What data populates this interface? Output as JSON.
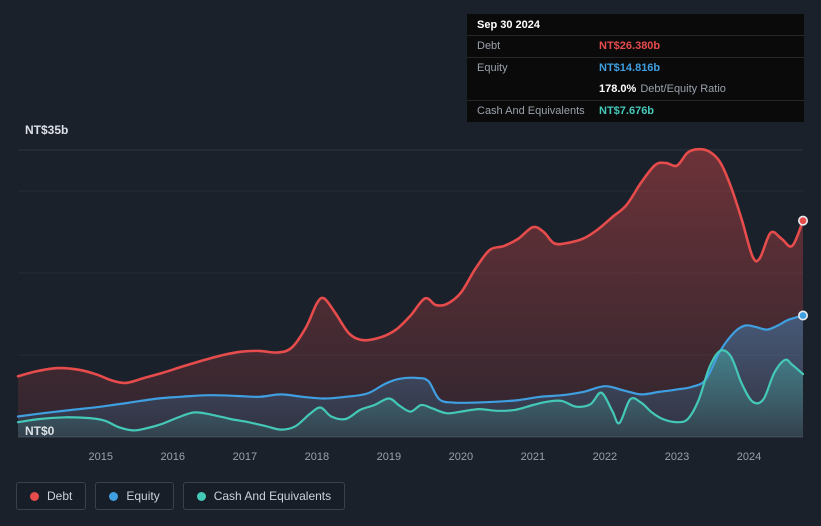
{
  "tooltip": {
    "date": "Sep 30 2024",
    "rows": [
      {
        "label": "Debt",
        "value": "NT$26.380b"
      },
      {
        "label": "Equity",
        "value": "NT$14.816b"
      },
      {
        "label": "",
        "value": "178.0%",
        "value_suffix": "Debt/Equity Ratio"
      },
      {
        "label": "Cash And Equivalents",
        "value": "NT$7.676b"
      }
    ]
  },
  "y_axis": {
    "max_label": "NT$35b",
    "min_label": "NT$0"
  },
  "x_axis": {
    "years": [
      "2015",
      "2016",
      "2017",
      "2018",
      "2019",
      "2020",
      "2021",
      "2022",
      "2023",
      "2024"
    ]
  },
  "legend": {
    "items": [
      {
        "label": "Debt",
        "color": "#e64c4c"
      },
      {
        "label": "Equity",
        "color": "#3f9fe0"
      },
      {
        "label": "Cash And Equivalents",
        "color": "#44c8b8"
      }
    ]
  },
  "colors": {
    "debt": "#e64c4c",
    "equity": "#3f9fe0",
    "cash": "#44c8b8",
    "background": "#1b212b",
    "tooltip_background": "#0a0a0b"
  },
  "chart_data": {
    "type": "area",
    "y_unit": "NT$ billions",
    "x_unit": "year",
    "x_range": [
      2013.85,
      2024.75
    ],
    "y_range": [
      0,
      35
    ],
    "gridlines_y": [
      10,
      20,
      30
    ],
    "legend_position": "bottom-left",
    "series": [
      {
        "name": "Debt",
        "color": "#e64c4c",
        "end_marker": true,
        "points": [
          [
            2013.85,
            7.4
          ],
          [
            2014.1,
            8.0
          ],
          [
            2014.4,
            8.4
          ],
          [
            2014.7,
            8.2
          ],
          [
            2014.95,
            7.6
          ],
          [
            2015.15,
            6.9
          ],
          [
            2015.35,
            6.6
          ],
          [
            2015.6,
            7.2
          ],
          [
            2015.85,
            7.8
          ],
          [
            2016.1,
            8.5
          ],
          [
            2016.4,
            9.3
          ],
          [
            2016.7,
            10.0
          ],
          [
            2016.95,
            10.4
          ],
          [
            2017.2,
            10.5
          ],
          [
            2017.45,
            10.3
          ],
          [
            2017.65,
            10.9
          ],
          [
            2017.85,
            13.4
          ],
          [
            2018.0,
            16.3
          ],
          [
            2018.1,
            16.9
          ],
          [
            2018.25,
            15.2
          ],
          [
            2018.45,
            12.6
          ],
          [
            2018.65,
            11.8
          ],
          [
            2018.9,
            12.2
          ],
          [
            2019.1,
            13.1
          ],
          [
            2019.3,
            14.8
          ],
          [
            2019.5,
            16.9
          ],
          [
            2019.65,
            16.1
          ],
          [
            2019.8,
            16.2
          ],
          [
            2020.0,
            17.6
          ],
          [
            2020.2,
            20.5
          ],
          [
            2020.4,
            22.8
          ],
          [
            2020.6,
            23.3
          ],
          [
            2020.8,
            24.2
          ],
          [
            2021.0,
            25.6
          ],
          [
            2021.15,
            25.0
          ],
          [
            2021.3,
            23.6
          ],
          [
            2021.5,
            23.7
          ],
          [
            2021.7,
            24.2
          ],
          [
            2021.9,
            25.3
          ],
          [
            2022.1,
            26.8
          ],
          [
            2022.3,
            28.3
          ],
          [
            2022.5,
            31.0
          ],
          [
            2022.7,
            33.2
          ],
          [
            2022.85,
            33.4
          ],
          [
            2023.0,
            33.1
          ],
          [
            2023.15,
            34.7
          ],
          [
            2023.3,
            35.1
          ],
          [
            2023.45,
            34.8
          ],
          [
            2023.6,
            33.5
          ],
          [
            2023.75,
            30.5
          ],
          [
            2023.9,
            26.5
          ],
          [
            2024.05,
            22.0
          ],
          [
            2024.15,
            21.8
          ],
          [
            2024.3,
            24.9
          ],
          [
            2024.45,
            24.2
          ],
          [
            2024.6,
            23.3
          ],
          [
            2024.75,
            26.38
          ]
        ]
      },
      {
        "name": "Equity",
        "color": "#3f9fe0",
        "end_marker": true,
        "points": [
          [
            2013.85,
            2.5
          ],
          [
            2014.2,
            2.9
          ],
          [
            2014.6,
            3.3
          ],
          [
            2015.0,
            3.7
          ],
          [
            2015.4,
            4.2
          ],
          [
            2015.8,
            4.7
          ],
          [
            2016.1,
            4.9
          ],
          [
            2016.5,
            5.1
          ],
          [
            2016.9,
            5.0
          ],
          [
            2017.2,
            4.9
          ],
          [
            2017.5,
            5.2
          ],
          [
            2017.8,
            4.9
          ],
          [
            2018.1,
            4.7
          ],
          [
            2018.4,
            4.9
          ],
          [
            2018.7,
            5.3
          ],
          [
            2018.95,
            6.5
          ],
          [
            2019.15,
            7.1
          ],
          [
            2019.4,
            7.2
          ],
          [
            2019.55,
            6.8
          ],
          [
            2019.7,
            4.6
          ],
          [
            2019.9,
            4.2
          ],
          [
            2020.2,
            4.2
          ],
          [
            2020.5,
            4.3
          ],
          [
            2020.8,
            4.5
          ],
          [
            2021.1,
            4.9
          ],
          [
            2021.4,
            5.1
          ],
          [
            2021.7,
            5.5
          ],
          [
            2022.0,
            6.2
          ],
          [
            2022.25,
            5.7
          ],
          [
            2022.5,
            5.2
          ],
          [
            2022.75,
            5.5
          ],
          [
            2023.0,
            5.8
          ],
          [
            2023.2,
            6.1
          ],
          [
            2023.4,
            7.0
          ],
          [
            2023.6,
            10.5
          ],
          [
            2023.8,
            12.8
          ],
          [
            2023.95,
            13.6
          ],
          [
            2024.1,
            13.4
          ],
          [
            2024.25,
            13.1
          ],
          [
            2024.4,
            13.6
          ],
          [
            2024.55,
            14.3
          ],
          [
            2024.75,
            14.816
          ]
        ]
      },
      {
        "name": "Cash And Equivalents",
        "color": "#44c8b8",
        "end_marker": false,
        "points": [
          [
            2013.85,
            1.8
          ],
          [
            2014.15,
            2.2
          ],
          [
            2014.5,
            2.4
          ],
          [
            2014.85,
            2.3
          ],
          [
            2015.05,
            2.0
          ],
          [
            2015.25,
            1.2
          ],
          [
            2015.45,
            0.8
          ],
          [
            2015.65,
            1.1
          ],
          [
            2015.85,
            1.6
          ],
          [
            2016.05,
            2.3
          ],
          [
            2016.3,
            3.0
          ],
          [
            2016.55,
            2.7
          ],
          [
            2016.8,
            2.2
          ],
          [
            2017.05,
            1.8
          ],
          [
            2017.3,
            1.3
          ],
          [
            2017.5,
            0.9
          ],
          [
            2017.7,
            1.3
          ],
          [
            2017.9,
            2.8
          ],
          [
            2018.05,
            3.6
          ],
          [
            2018.2,
            2.5
          ],
          [
            2018.4,
            2.2
          ],
          [
            2018.6,
            3.3
          ],
          [
            2018.8,
            3.9
          ],
          [
            2019.0,
            4.7
          ],
          [
            2019.15,
            3.8
          ],
          [
            2019.3,
            3.1
          ],
          [
            2019.45,
            3.9
          ],
          [
            2019.6,
            3.5
          ],
          [
            2019.8,
            2.9
          ],
          [
            2020.0,
            3.1
          ],
          [
            2020.25,
            3.4
          ],
          [
            2020.5,
            3.2
          ],
          [
            2020.75,
            3.3
          ],
          [
            2021.0,
            3.9
          ],
          [
            2021.2,
            4.3
          ],
          [
            2021.4,
            4.4
          ],
          [
            2021.6,
            3.7
          ],
          [
            2021.8,
            4.0
          ],
          [
            2021.95,
            5.4
          ],
          [
            2022.1,
            3.2
          ],
          [
            2022.2,
            1.7
          ],
          [
            2022.35,
            4.6
          ],
          [
            2022.5,
            4.2
          ],
          [
            2022.65,
            3.0
          ],
          [
            2022.8,
            2.2
          ],
          [
            2023.0,
            1.8
          ],
          [
            2023.15,
            2.2
          ],
          [
            2023.3,
            4.5
          ],
          [
            2023.45,
            8.5
          ],
          [
            2023.6,
            10.5
          ],
          [
            2023.75,
            9.8
          ],
          [
            2023.9,
            6.5
          ],
          [
            2024.05,
            4.3
          ],
          [
            2024.2,
            4.6
          ],
          [
            2024.35,
            7.8
          ],
          [
            2024.5,
            9.4
          ],
          [
            2024.6,
            8.8
          ],
          [
            2024.75,
            7.676
          ]
        ]
      }
    ]
  }
}
